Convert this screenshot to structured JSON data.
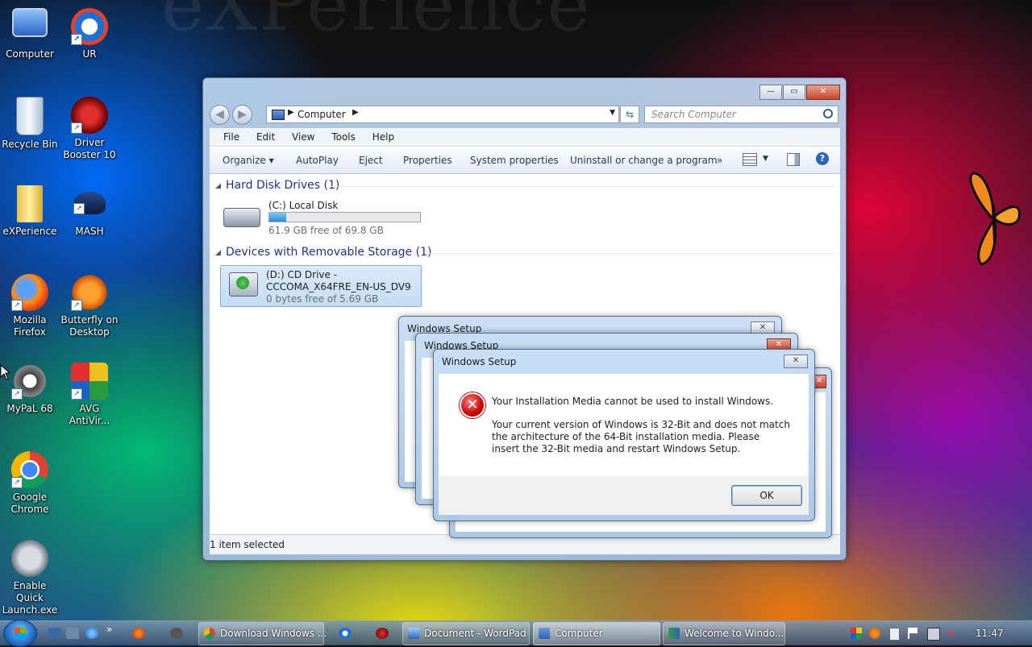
{
  "desktop": {
    "icons": [
      {
        "label": "Computer"
      },
      {
        "label": "UR"
      },
      {
        "label": "Recycle Bin"
      },
      {
        "label": "Driver Booster 10"
      },
      {
        "label": "eXPerience"
      },
      {
        "label": "MASH"
      },
      {
        "label": "Mozilla Firefox"
      },
      {
        "label": "Butterfly on Desktop"
      },
      {
        "label": "MyPaL 68"
      },
      {
        "label": "AVG AntiVir..."
      },
      {
        "label": "Google Chrome"
      },
      {
        "label": "Enable Quick Launch.exe"
      }
    ]
  },
  "explorer": {
    "address": "Computer",
    "search_placeholder": "Search Computer",
    "menu": [
      "File",
      "Edit",
      "View",
      "Tools",
      "Help"
    ],
    "commands": [
      "Organize ▾",
      "AutoPlay",
      "Eject",
      "Properties",
      "System properties",
      "Uninstall or change a program",
      "»"
    ],
    "groups": [
      {
        "title": "Hard Disk Drives (1)"
      },
      {
        "title": "Devices with Removable Storage (1)"
      }
    ],
    "drives": [
      {
        "name": "(C:) Local Disk",
        "info": "61.9 GB free of 69.8 GB",
        "used_fraction": 0.11
      },
      {
        "name": "(D:) CD Drive -",
        "name2": "CCCOMA_X64FRE_EN-US_DV9",
        "info": "0 bytes free of 5.69 GB"
      }
    ],
    "status": "1 item selected"
  },
  "dialogs": {
    "title1": "Windows Setup",
    "title2": "Windows Setup",
    "title3": "Windows Setup",
    "heading": "Your Installation Media cannot be used to install Windows.",
    "body": "Your current version of Windows is 32-Bit and does not match the architecture of the 64-Bit installation media. Please insert the 32-Bit media and restart Windows Setup.",
    "ok": "OK"
  },
  "taskbar": {
    "buttons": [
      {
        "label": "Download Windows ..."
      },
      {
        "label": "Document - WordPad"
      },
      {
        "label": "Computer"
      },
      {
        "label": "Welcome to Windo..."
      }
    ],
    "quick_more": "»",
    "clock": "11:47"
  }
}
